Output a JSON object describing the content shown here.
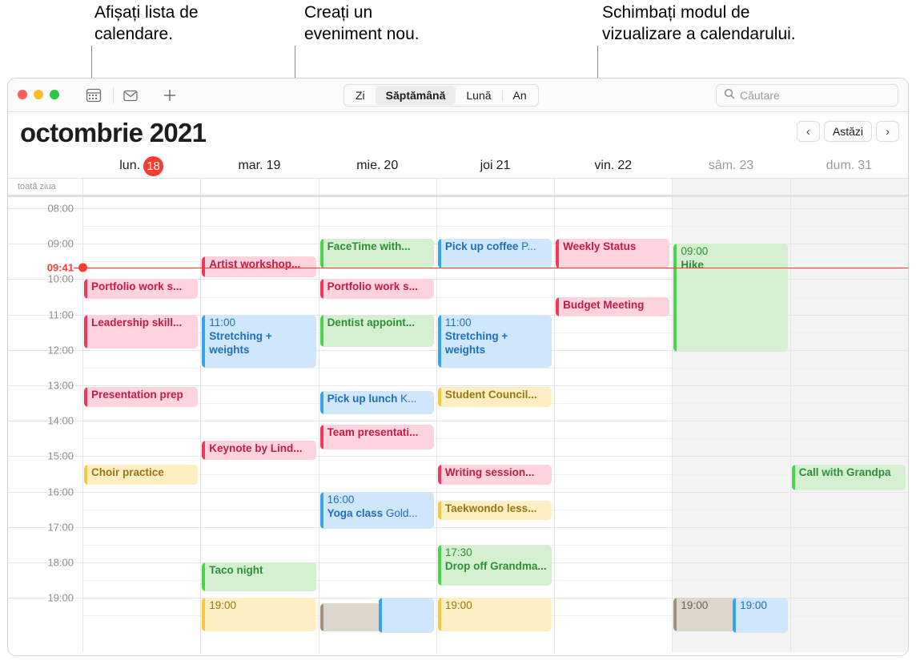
{
  "callouts": [
    {
      "text": "Afișați lista de\ncalendare.",
      "name": "callout-calendar-list"
    },
    {
      "text": "Creați un\neveniment nou.",
      "name": "callout-new-event"
    },
    {
      "text": "Schimbați modul de\nvizualizare a calendarului.",
      "name": "callout-view-mode"
    }
  ],
  "window": {
    "traffic_lights": [
      "close",
      "minimize",
      "zoom"
    ],
    "toolbar": {
      "calendar_list_icon": "calendar-icon",
      "inbox_icon": "inbox-icon",
      "new_event_label": "+",
      "view_modes": [
        {
          "label": "Zi",
          "selected": false
        },
        {
          "label": "Săptămână",
          "selected": true
        },
        {
          "label": "Lună",
          "selected": false
        },
        {
          "label": "An",
          "selected": false
        }
      ],
      "search": {
        "icon": "search-icon",
        "placeholder": "Căutare",
        "value": ""
      }
    },
    "month_title": "octombrie 2021",
    "nav": {
      "prev": "‹",
      "today": "Astăzi",
      "next": "›"
    },
    "all_day_label": "toată ziua",
    "days": [
      {
        "weekday": "lun.",
        "daynum": "18",
        "today": true,
        "weekend": false
      },
      {
        "weekday": "mar.",
        "daynum": "19",
        "today": false,
        "weekend": false
      },
      {
        "weekday": "mie.",
        "daynum": "20",
        "today": false,
        "weekend": false
      },
      {
        "weekday": "joi",
        "daynum": "21",
        "today": false,
        "weekend": false
      },
      {
        "weekday": "vin.",
        "daynum": "22",
        "today": false,
        "weekend": false
      },
      {
        "weekday": "sâm.",
        "daynum": "23",
        "today": false,
        "weekend": true
      },
      {
        "weekday": "dum.",
        "daynum": "31",
        "today": false,
        "weekend": true
      }
    ],
    "hours": [
      "08:00",
      "09:00",
      "10:00",
      "11:00",
      "12:00",
      "13:00",
      "14:00",
      "15:00",
      "16:00",
      "17:00",
      "18:00",
      "19:00"
    ],
    "current_time": "09:41",
    "colors": {
      "accent_red": "#ff3b30",
      "event_pink": "#f4365e",
      "event_blue": "#36a3f0",
      "event_green": "#4cd34c",
      "event_yellow": "#f8c83c",
      "event_gray": "#a3907c"
    },
    "events": [
      {
        "day": 0,
        "start": 10.0,
        "end": 10.6,
        "title": "Portfolio work s...",
        "time": "",
        "location": "",
        "color": "c-pink",
        "multiline": false
      },
      {
        "day": 0,
        "start": 11.0,
        "end": 12.0,
        "title": "Leadership skill...",
        "time": "",
        "location": "",
        "color": "c-pink",
        "multiline": false
      },
      {
        "day": 0,
        "start": 13.05,
        "end": 13.65,
        "title": "Presentation prep",
        "time": "",
        "location": "",
        "color": "c-pink",
        "multiline": false
      },
      {
        "day": 0,
        "start": 15.25,
        "end": 15.85,
        "title": "Choir practice",
        "time": "",
        "location": "",
        "color": "c-yellow",
        "multiline": false
      },
      {
        "day": 1,
        "start": 9.35,
        "end": 10.0,
        "title": "Artist workshop...",
        "time": "",
        "location": "",
        "color": "c-pink",
        "multiline": false
      },
      {
        "day": 1,
        "start": 11.0,
        "end": 12.55,
        "title": "Stretching + weights",
        "time": "11:00",
        "location": "",
        "color": "c-blue",
        "multiline": true
      },
      {
        "day": 1,
        "start": 14.55,
        "end": 15.15,
        "title": "Keynote by Lind...",
        "time": "",
        "location": "",
        "color": "c-pink",
        "multiline": false
      },
      {
        "day": 1,
        "start": 18.0,
        "end": 18.85,
        "title": "Taco night",
        "time": "",
        "location": "",
        "color": "c-green",
        "multiline": false
      },
      {
        "day": 1,
        "start": 19.0,
        "end": 20.0,
        "title": "",
        "time": "19:00",
        "location": "",
        "color": "c-yellow",
        "multiline": true
      },
      {
        "day": 2,
        "start": 8.85,
        "end": 9.75,
        "title": "FaceTime with...",
        "time": "",
        "location": "",
        "color": "c-green",
        "multiline": false
      },
      {
        "day": 2,
        "start": 10.0,
        "end": 10.6,
        "title": "Portfolio work s...",
        "time": "",
        "location": "",
        "color": "c-pink",
        "multiline": false
      },
      {
        "day": 2,
        "start": 11.0,
        "end": 11.95,
        "title": "Dentist appoint...",
        "time": "",
        "location": "",
        "color": "c-green",
        "multiline": false
      },
      {
        "day": 2,
        "start": 13.15,
        "end": 13.85,
        "title": "Pick up lunch",
        "time": "",
        "location": "K...",
        "color": "c-blue",
        "multiline": false
      },
      {
        "day": 2,
        "start": 14.1,
        "end": 14.85,
        "title": "Team presentati...",
        "time": "",
        "location": "",
        "color": "c-pink",
        "multiline": false
      },
      {
        "day": 2,
        "start": 16.0,
        "end": 17.1,
        "title": "Yoga class",
        "time": "16:00",
        "location": "Gold...",
        "color": "c-blue",
        "multiline": true
      },
      {
        "day": 2,
        "start": 19.15,
        "end": 20.0,
        "title": "",
        "time": "",
        "location": "",
        "color": "c-gray",
        "multiline": false
      },
      {
        "day": 3,
        "start": 8.85,
        "end": 9.75,
        "title": "Pick up coffee",
        "time": "",
        "location": "P...",
        "color": "c-blue",
        "multiline": false
      },
      {
        "day": 3,
        "start": 11.0,
        "end": 12.55,
        "title": "Stretching + weights",
        "time": "11:00",
        "location": "",
        "color": "c-blue",
        "multiline": true
      },
      {
        "day": 3,
        "start": 13.05,
        "end": 13.65,
        "title": "Student Council...",
        "time": "",
        "location": "",
        "color": "c-yellow",
        "multiline": false
      },
      {
        "day": 3,
        "start": 15.25,
        "end": 15.85,
        "title": "Writing session...",
        "time": "",
        "location": "",
        "color": "c-pink",
        "multiline": false
      },
      {
        "day": 3,
        "start": 16.25,
        "end": 16.85,
        "title": "Taekwondo less...",
        "time": "",
        "location": "",
        "color": "c-yellow",
        "multiline": false
      },
      {
        "day": 3,
        "start": 17.5,
        "end": 18.7,
        "title": "Drop off Grandma...",
        "time": "17:30",
        "location": "",
        "color": "c-green",
        "multiline": true
      },
      {
        "day": 3,
        "start": 19.0,
        "end": 20.0,
        "title": "",
        "time": "19:00",
        "location": "",
        "color": "c-yellow",
        "multiline": true
      },
      {
        "day": 4,
        "start": 8.85,
        "end": 9.75,
        "title": "Weekly Status",
        "time": "",
        "location": "",
        "color": "c-pink",
        "multiline": false
      },
      {
        "day": 4,
        "start": 10.5,
        "end": 11.1,
        "title": "Budget Meeting",
        "time": "",
        "location": "",
        "color": "c-pink",
        "multiline": false
      },
      {
        "day": 5,
        "start": 9.0,
        "end": 12.1,
        "title": "Hike",
        "time": "09:00",
        "location": "",
        "color": "c-green",
        "multiline": true
      },
      {
        "day": 5,
        "start": 19.0,
        "end": 20.0,
        "title": "",
        "time": "19:00",
        "location": "",
        "color": "c-gray",
        "multiline": true
      },
      {
        "day": 6,
        "start": 15.25,
        "end": 16.0,
        "title": "Call with Grandpa",
        "time": "",
        "location": "",
        "color": "c-green",
        "multiline": false
      }
    ],
    "partial_events": [
      {
        "day": 2,
        "x_offset": 0.5,
        "color": "c-blue",
        "time": ""
      },
      {
        "day": 5,
        "x_offset": 0.5,
        "color": "c-blue",
        "time": "19:00"
      }
    ]
  }
}
